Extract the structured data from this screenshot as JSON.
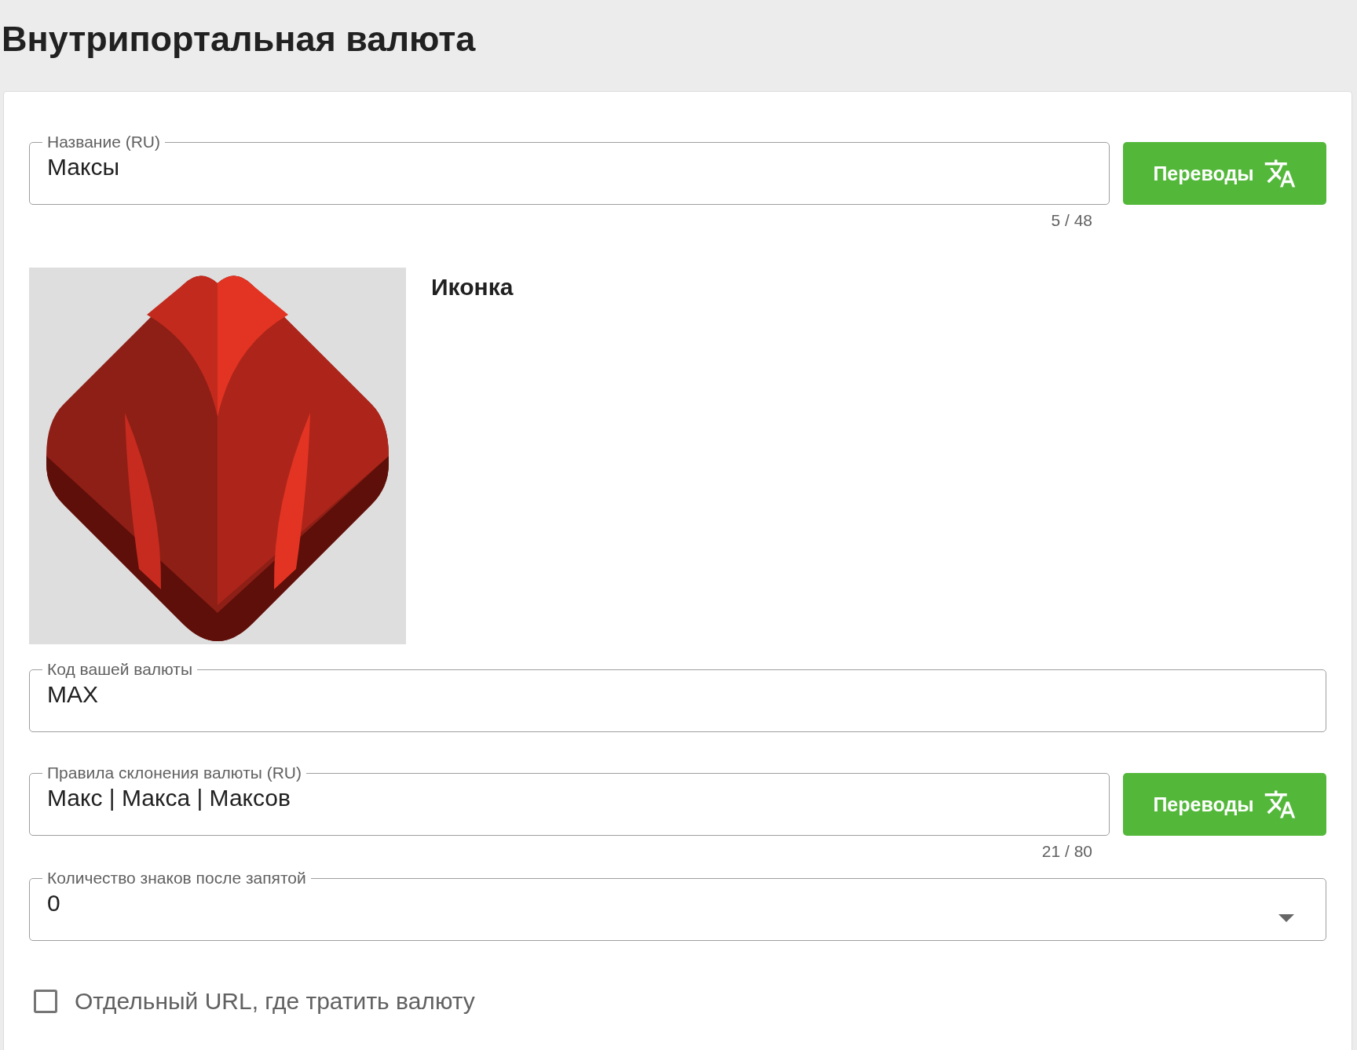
{
  "title": "Внутрипортальная валюта",
  "name_field": {
    "label": "Название (RU)",
    "value": "Максы",
    "counter": "5 / 48",
    "button": "Переводы"
  },
  "icon_section": {
    "label": "Иконка",
    "kind": "picture"
  },
  "fields": [
    {
      "kind": "text",
      "label": "Код вашей валюты",
      "value": "MAX"
    },
    {
      "kind": "text",
      "label": "Правила склонения валюты (RU)",
      "value": "Макс | Макса | Максов",
      "counter": "21 / 80",
      "button": "Переводы"
    },
    {
      "kind": "select",
      "label": "Количество знаков после запятой",
      "value": "0"
    }
  ],
  "checkbox": {
    "label": "Отдельный URL, где тратить валюту",
    "checked": false
  }
}
